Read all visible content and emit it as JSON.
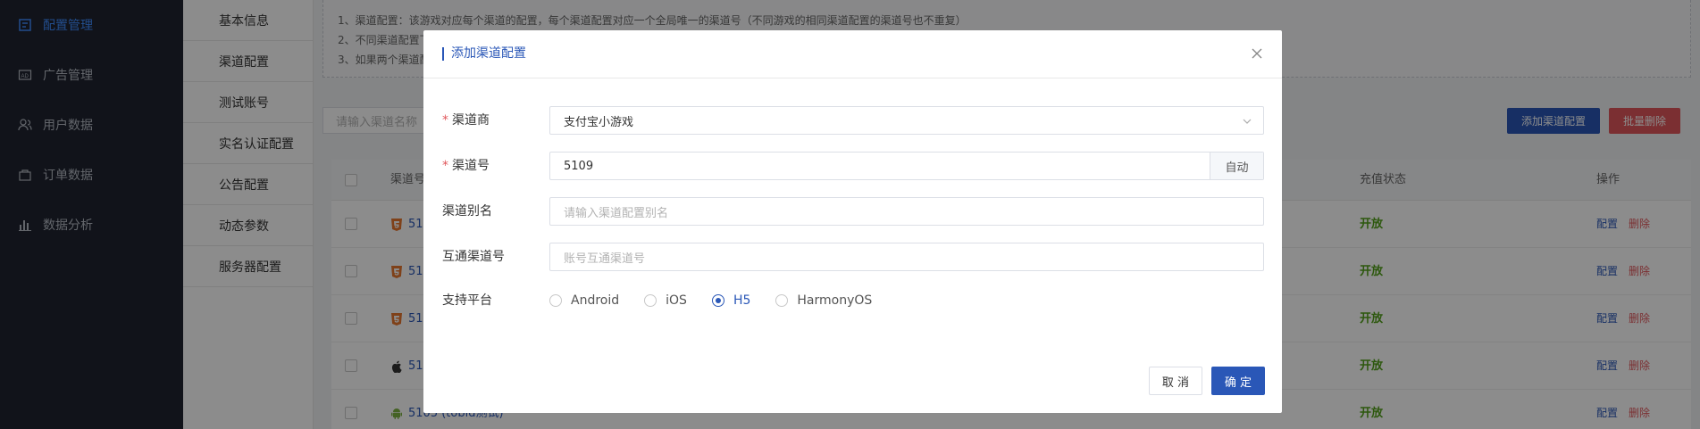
{
  "sidebar": {
    "items": [
      {
        "label": "配置管理",
        "icon": "config-icon",
        "active": true
      },
      {
        "label": "广告管理",
        "icon": "ad-icon"
      },
      {
        "label": "用户数据",
        "icon": "users-icon"
      },
      {
        "label": "订单数据",
        "icon": "order-icon"
      },
      {
        "label": "数据分析",
        "icon": "chart-icon"
      }
    ]
  },
  "submenu": {
    "items": [
      "基本信息",
      "渠道配置",
      "测试账号",
      "实名认证配置",
      "公告配置",
      "动态参数",
      "服务器配置"
    ]
  },
  "notice": {
    "lines": [
      "1、渠道配置：该游戏对应每个渠道的配置，每个渠道配置对应一个全局唯一的渠道号（不同游戏的相同渠道配置的渠道号也不重复）",
      "2、不同渠道配置下",
      "3、如果两个渠道配"
    ]
  },
  "toolbar": {
    "search_placeholder": "请输入渠道名称",
    "add_label": "添加渠道配置",
    "batch_delete_label": "批量删除"
  },
  "table": {
    "headers": {
      "channel": "渠道号",
      "recharge": "充值状态",
      "ops": "操作"
    },
    "rows": [
      {
        "platform": "html5-icon",
        "name": "51",
        "status": "开放"
      },
      {
        "platform": "html5-icon",
        "name": "51",
        "status": "开放"
      },
      {
        "platform": "html5-icon",
        "name": "51",
        "status": "开放"
      },
      {
        "platform": "apple-icon",
        "name": "51",
        "status": "开放"
      },
      {
        "platform": "android-icon",
        "name": "5105 (tobid测试)",
        "status": "开放"
      }
    ],
    "op_config": "配置",
    "op_delete": "删除"
  },
  "dialog": {
    "title": "添加渠道配置",
    "fields": {
      "merchant_label": "渠道商",
      "merchant_value": "支付宝小游戏",
      "channel_no_label": "渠道号",
      "channel_no_value": "5109",
      "auto_label": "自动",
      "alias_label": "渠道别名",
      "alias_placeholder": "请输入渠道配置别名",
      "interop_label": "互通渠道号",
      "interop_placeholder": "账号互通渠道号",
      "platform_label": "支持平台"
    },
    "platforms": [
      {
        "label": "Android",
        "checked": false
      },
      {
        "label": "iOS",
        "checked": false
      },
      {
        "label": "H5",
        "checked": true
      },
      {
        "label": "HarmonyOS",
        "checked": false
      }
    ],
    "cancel_label": "取 消",
    "ok_label": "确 定"
  }
}
